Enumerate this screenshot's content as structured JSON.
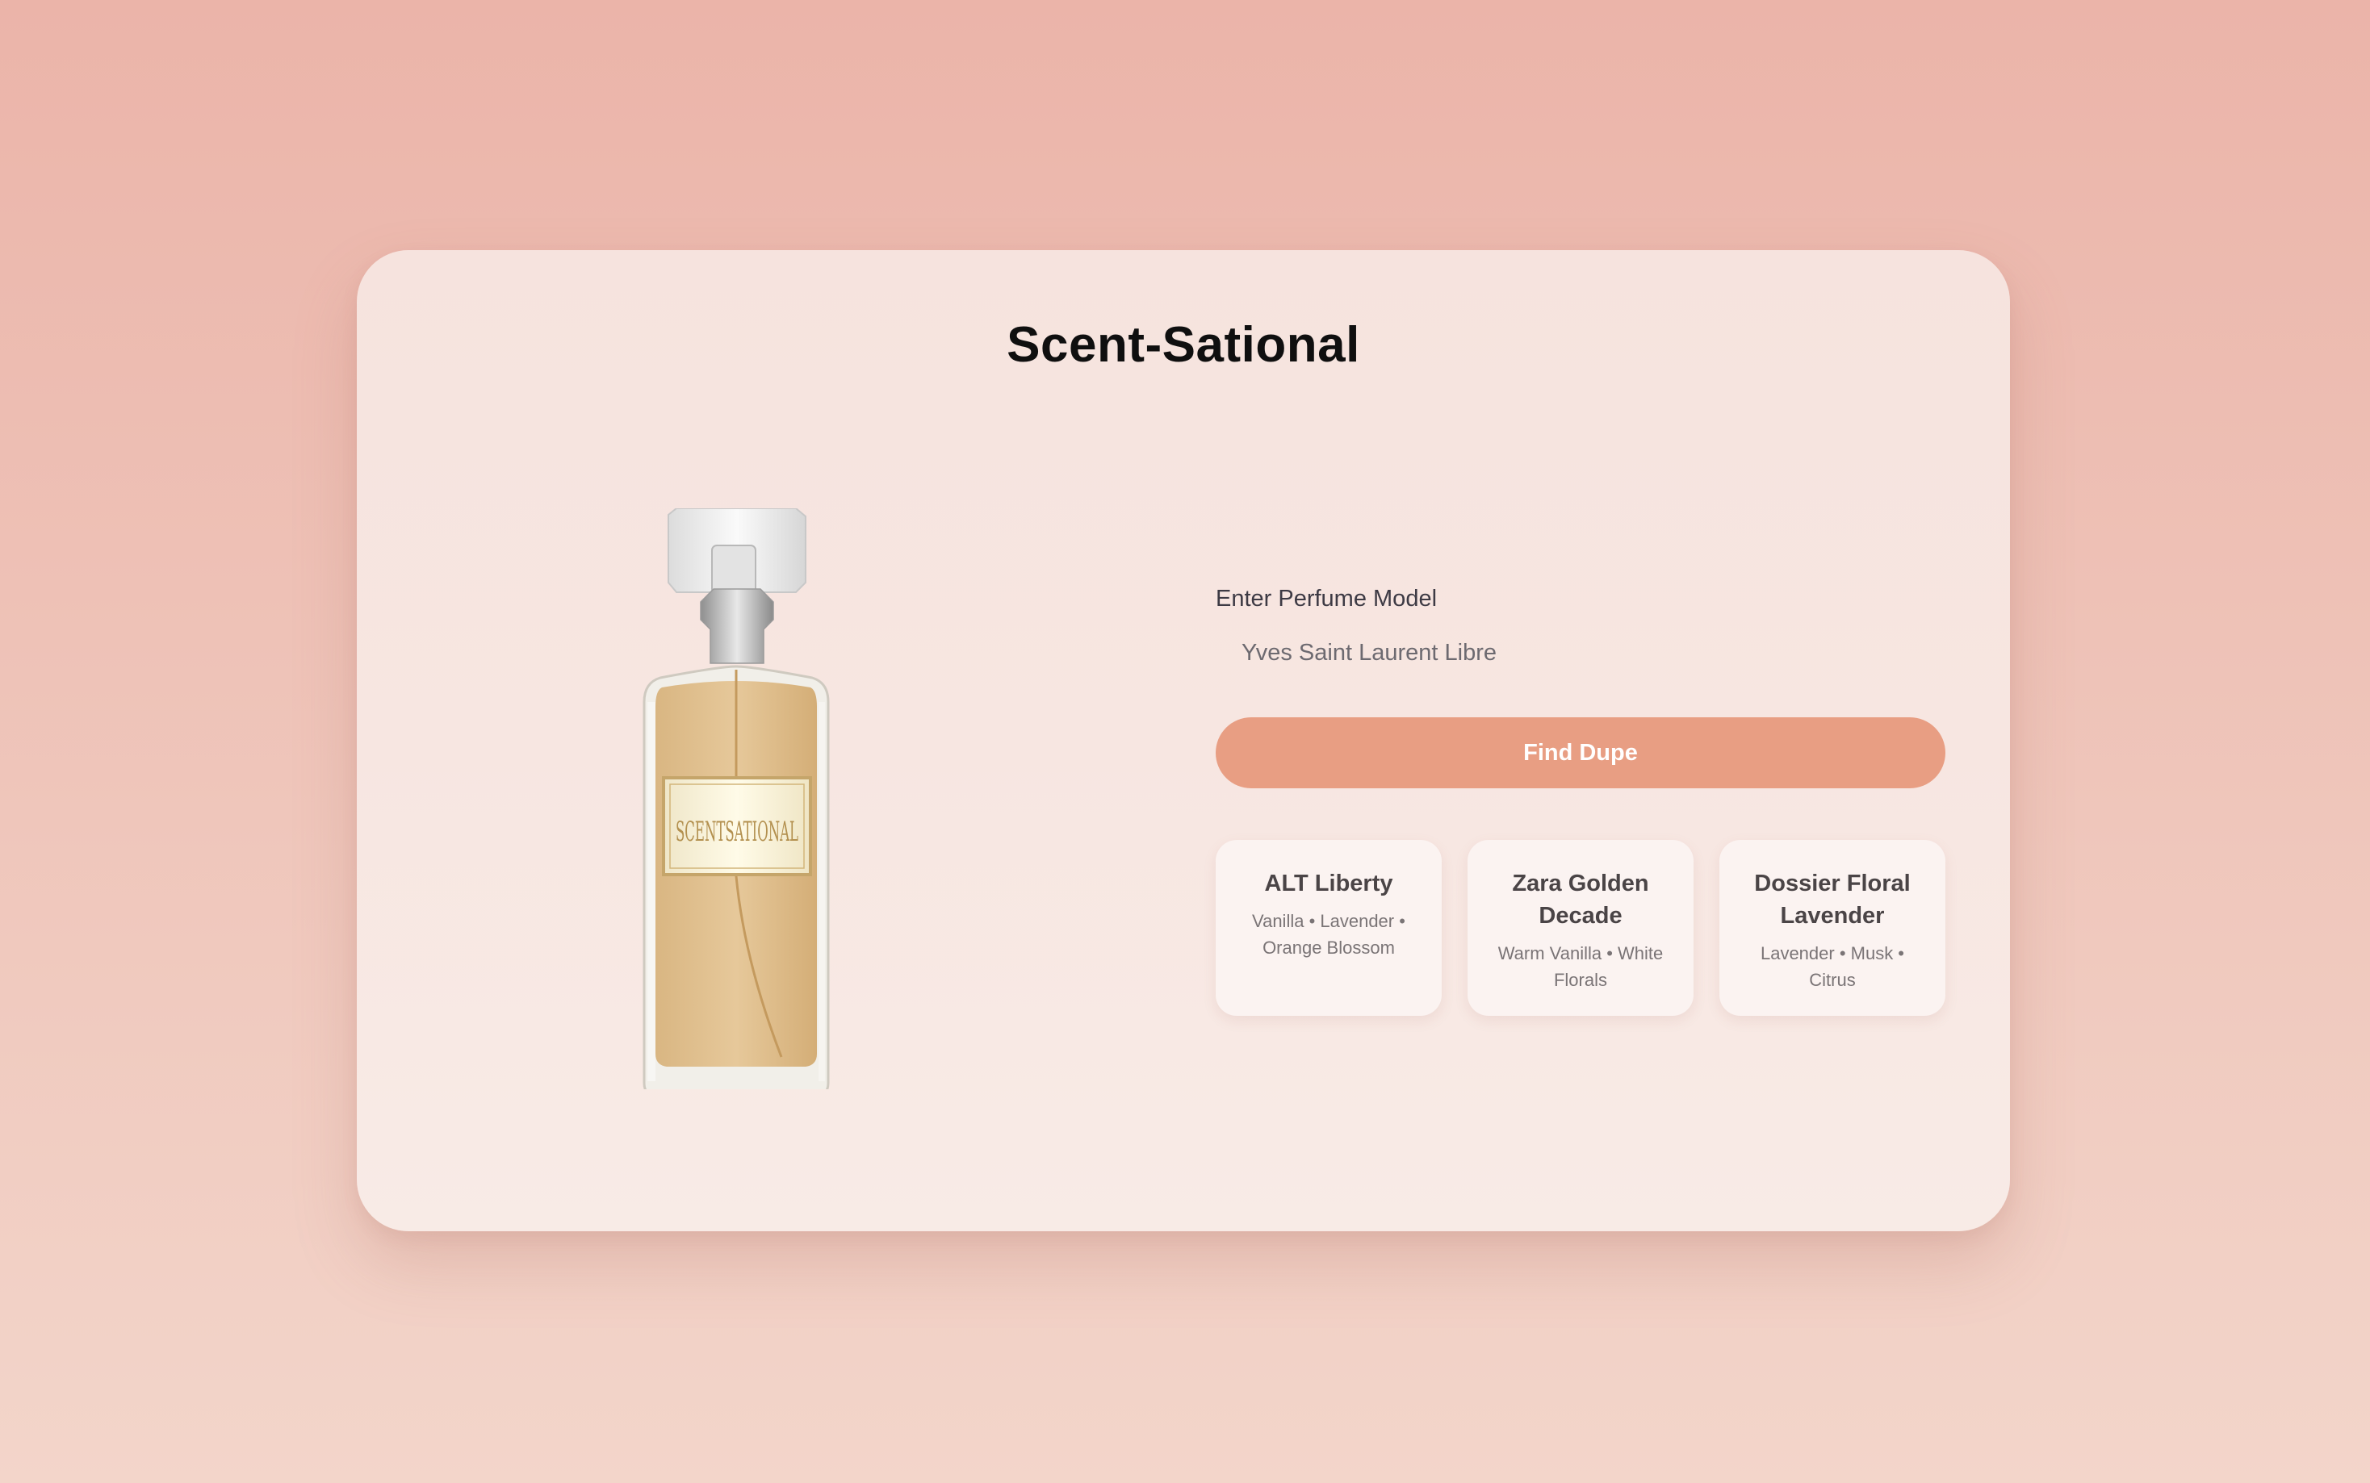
{
  "app": {
    "title": "Scent-Sational"
  },
  "hero": {
    "bottle_label": "SCENTSATIONAL"
  },
  "form": {
    "label": "Enter Perfume Model",
    "input_value": "Yves Saint Laurent Libre",
    "button_label": "Find Dupe"
  },
  "results": [
    {
      "name": "ALT Liberty",
      "notes": "Vanilla • Lavender • Orange Blossom"
    },
    {
      "name": "Zara Golden Decade",
      "notes": "Warm Vanilla • White Florals"
    },
    {
      "name": "Dossier Floral Lavender",
      "notes": "Lavender • Musk • Citrus"
    }
  ],
  "colors": {
    "background": "#ebb4a9",
    "card": "#f7e6e1",
    "accent": "#e89e83",
    "title": "#0f0f0f"
  }
}
